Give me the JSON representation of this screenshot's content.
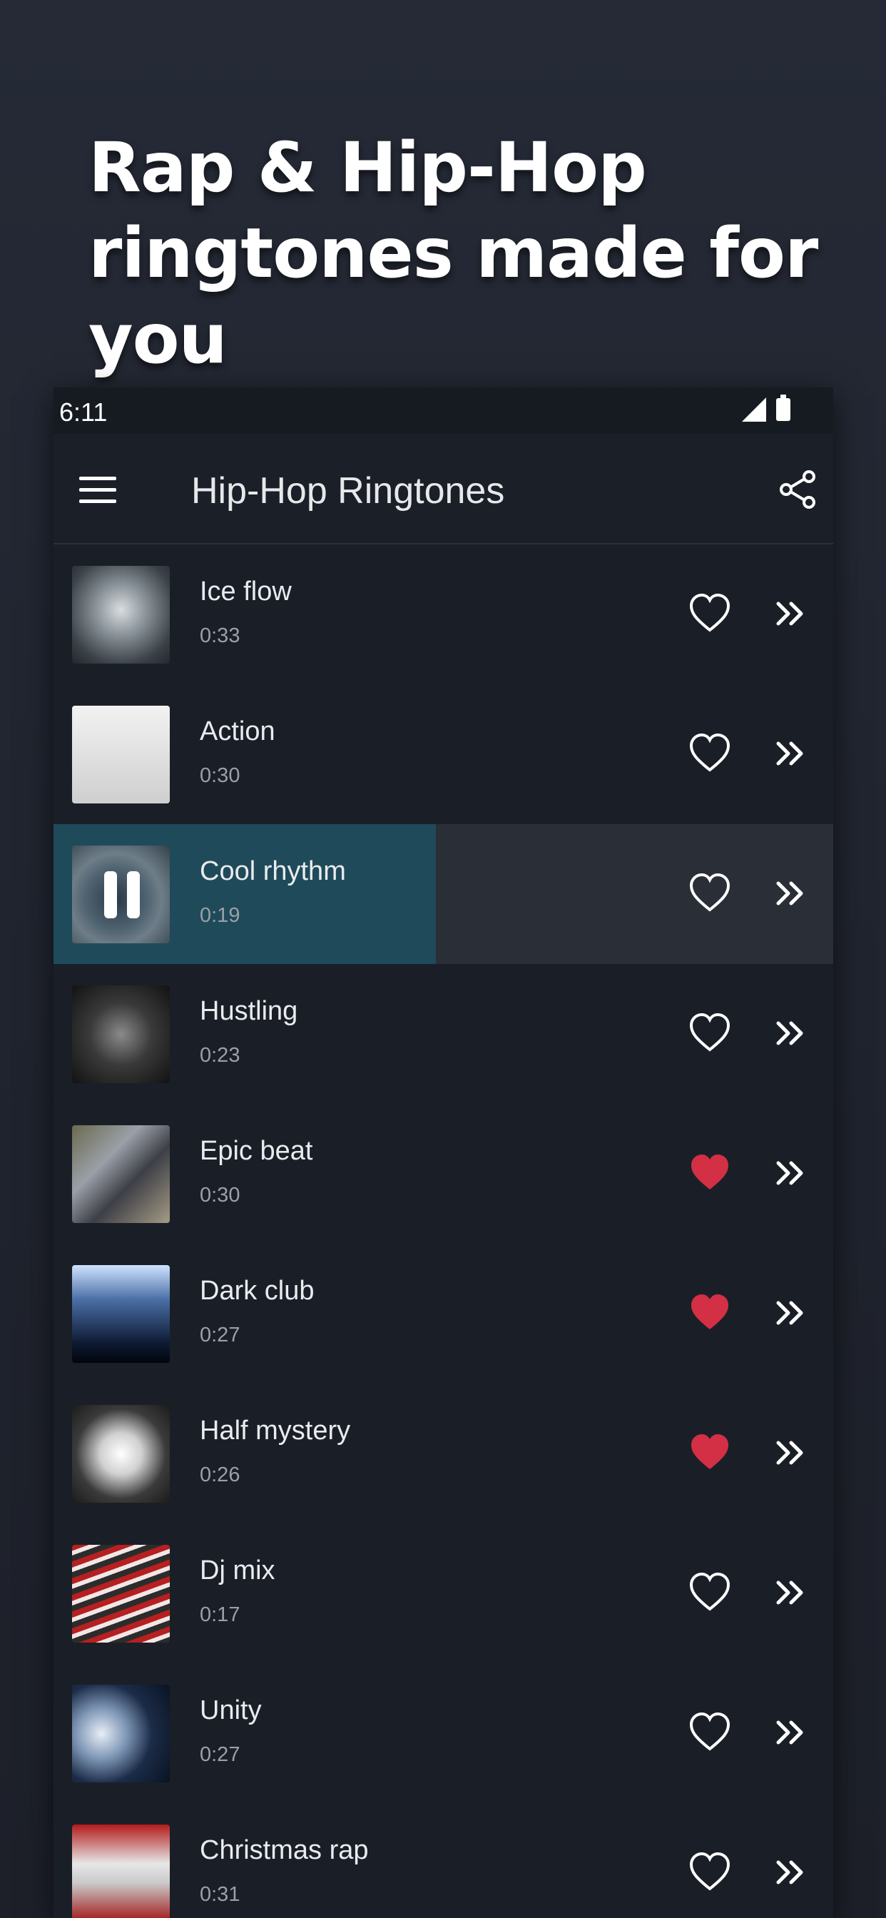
{
  "promo": {
    "line1": "Rap & Hip-Hop",
    "line2": "ringtones made for you"
  },
  "status_bar": {
    "time": "6:11",
    "icons": [
      "signal-icon",
      "battery-icon"
    ]
  },
  "app_bar": {
    "title": "Hip-Hop Ringtones",
    "left_icon": "menu-icon",
    "right_icon": "share-icon"
  },
  "colors": {
    "background": "#252a36",
    "list_bg": "#1a1f27",
    "playing_row": "#2a2f37",
    "progress_fill": "#1f4a5a",
    "heart_active": "#d32f45"
  },
  "ringtones": [
    {
      "title": "Ice flow",
      "duration": "0:33",
      "favorite": false,
      "thumb": "smoke"
    },
    {
      "title": "Action",
      "duration": "0:30",
      "favorite": false,
      "thumb": "dancer"
    },
    {
      "title": "Cool rhythm",
      "duration": "0:19",
      "favorite": false,
      "playing": true,
      "progress": 0.49,
      "thumb": "turntable"
    },
    {
      "title": "Hustling",
      "duration": "0:23",
      "favorite": false,
      "thumb": "watch"
    },
    {
      "title": "Epic beat",
      "duration": "0:30",
      "favorite": true,
      "thumb": "graffiti"
    },
    {
      "title": "Dark club",
      "duration": "0:27",
      "favorite": true,
      "thumb": "club"
    },
    {
      "title": "Half mystery",
      "duration": "0:26",
      "favorite": true,
      "thumb": "powder"
    },
    {
      "title": "Dj mix",
      "duration": "0:17",
      "favorite": false,
      "thumb": "mixer"
    },
    {
      "title": "Unity",
      "duration": "0:27",
      "favorite": false,
      "thumb": "speaker"
    },
    {
      "title": "Christmas rap",
      "duration": "0:31",
      "favorite": false,
      "thumb": "santa"
    }
  ]
}
